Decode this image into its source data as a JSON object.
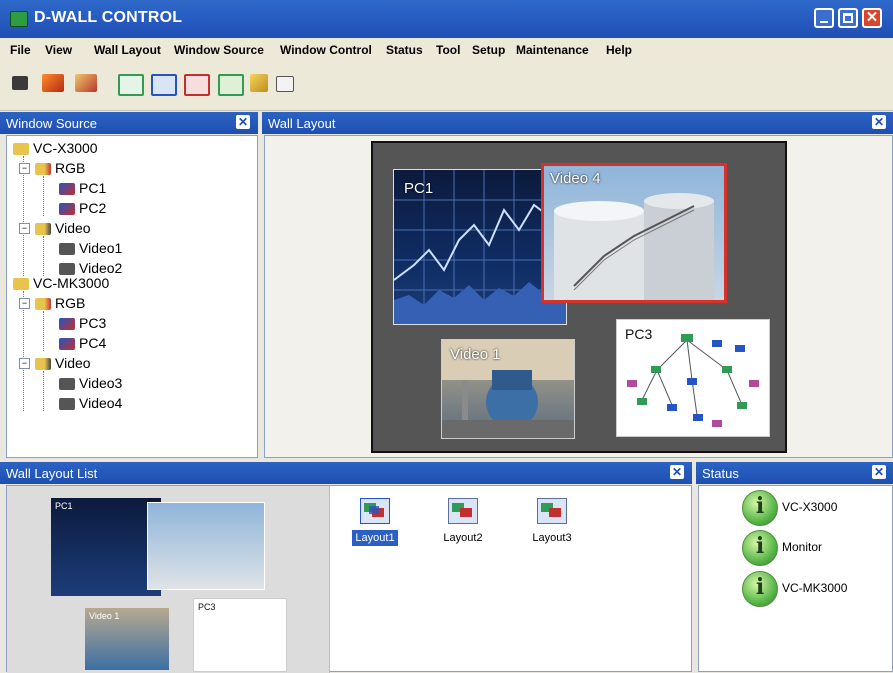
{
  "window": {
    "title": "D-WALL CONTROL"
  },
  "menu": [
    "File",
    "View",
    "Wall Layout",
    "Window Source",
    "Window Control",
    "Status",
    "Tool",
    "Setup",
    "Maintenance",
    "Help"
  ],
  "toolbar_icons": [
    "record-icon",
    "import-icon",
    "export-icon",
    "window-green-icon",
    "window-blue-icon",
    "window-red-icon",
    "window-split-icon",
    "pointer-icon",
    "help-book-icon"
  ],
  "window_source": {
    "title": "Window Source",
    "tree": [
      {
        "label": "VC-X3000"
      },
      {
        "label": "RGB"
      },
      {
        "label": "PC1"
      },
      {
        "label": "PC2"
      },
      {
        "label": "Video"
      },
      {
        "label": "Video1"
      },
      {
        "label": "Video2"
      },
      {
        "label": "VC-MK3000"
      },
      {
        "label": "RGB"
      },
      {
        "label": "PC3"
      },
      {
        "label": "PC4"
      },
      {
        "label": "Video"
      },
      {
        "label": "Video3"
      },
      {
        "label": "Video4"
      }
    ]
  },
  "wall_layout": {
    "title": "Wall Layout",
    "windows": [
      {
        "label": "PC1"
      },
      {
        "label": "Video 4"
      },
      {
        "label": "Video 1"
      },
      {
        "label": "PC3"
      }
    ]
  },
  "wall_layout_list": {
    "title": "Wall Layout List",
    "preview_labels": {
      "pc1": "PC1",
      "video1": "Video 1",
      "pc3": "PC3"
    },
    "items": [
      "Layout1",
      "Layout2",
      "Layout3"
    ],
    "selected": "Layout1"
  },
  "status": {
    "title": "Status",
    "items": [
      "VC-X3000",
      "Monitor",
      "VC-MK3000"
    ]
  },
  "colors": {
    "accent": "#1d4fb1",
    "selection_border": "#d8312a",
    "close": "#d9452b"
  }
}
